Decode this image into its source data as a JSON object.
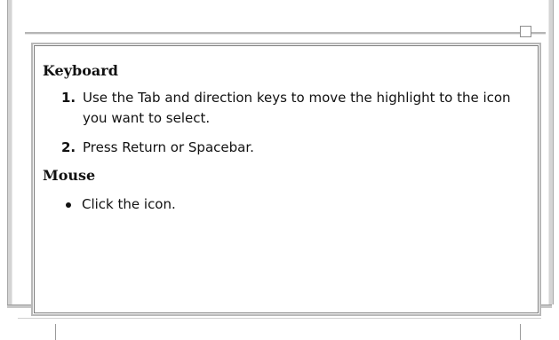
{
  "help": {
    "keyboard_heading": "Keyboard",
    "steps": [
      {
        "number": "1.",
        "text": "Use the Tab and direction keys to move the highlight to the icon you want to select."
      },
      {
        "number": "2.",
        "text": "Press Return or Spacebar."
      }
    ],
    "mouse_heading": "Mouse",
    "bullets": [
      {
        "text": "Click the icon."
      }
    ]
  },
  "colors": {
    "frame": "#d4d4d4",
    "border": "#b8b8b8",
    "text": "#111111",
    "background": "#ffffff"
  }
}
